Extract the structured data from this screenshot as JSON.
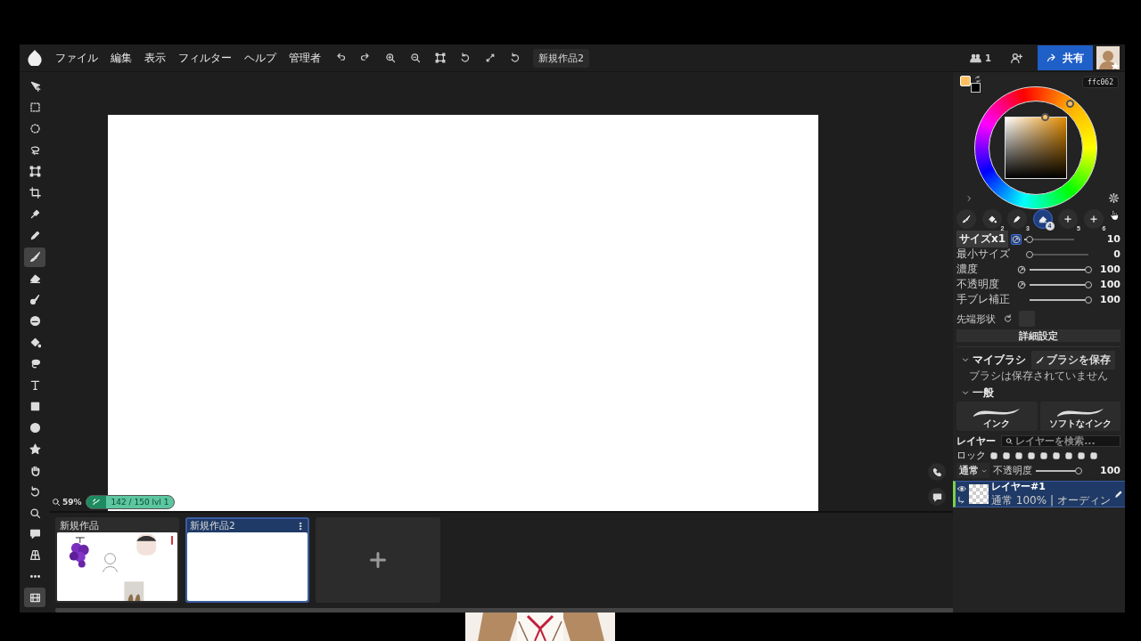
{
  "menubar": {
    "menus": [
      "ファイル",
      "編集",
      "表示",
      "フィルター",
      "ヘルプ",
      "管理者"
    ],
    "document_title": "新規作品2",
    "member_count": "1",
    "share_label": "共有"
  },
  "tools": [
    {
      "kind": "move",
      "selected": false
    },
    {
      "kind": "rect-select",
      "selected": false
    },
    {
      "kind": "ellipse-select",
      "selected": false
    },
    {
      "kind": "lasso",
      "selected": false
    },
    {
      "kind": "transform",
      "selected": false
    },
    {
      "kind": "crop",
      "selected": false
    },
    {
      "kind": "eyedropper",
      "selected": false
    },
    {
      "kind": "pencil",
      "selected": false
    },
    {
      "kind": "brush",
      "selected": true
    },
    {
      "kind": "eraser",
      "selected": false
    },
    {
      "kind": "brush-blur",
      "selected": false
    },
    {
      "kind": "smudge",
      "selected": false
    },
    {
      "kind": "bucket",
      "selected": false
    },
    {
      "kind": "lasso-fill",
      "selected": false
    },
    {
      "kind": "text",
      "selected": false
    },
    {
      "kind": "rectangle",
      "selected": false
    },
    {
      "kind": "ellipse",
      "selected": false
    },
    {
      "kind": "star",
      "selected": false
    },
    {
      "kind": "hand",
      "selected": false
    },
    {
      "kind": "rotate",
      "selected": false
    },
    {
      "kind": "zoom",
      "selected": false
    },
    {
      "kind": "comment",
      "selected": false
    },
    {
      "kind": "perspective",
      "selected": false
    },
    {
      "kind": "more",
      "selected": false
    },
    {
      "kind": "film",
      "selected": true
    }
  ],
  "canvas": {
    "zoom": "59%",
    "progress": "142 / 150  lvl 1"
  },
  "documents": [
    {
      "title": "新規作品",
      "selected": false,
      "kind": "picture"
    },
    {
      "title": "新規作品2",
      "selected": true,
      "kind": "blank"
    }
  ],
  "color": {
    "hex": "ffc062"
  },
  "brush_slots": [
    {
      "kind": "brush",
      "selected": false
    },
    {
      "kind": "bucket",
      "number": "2",
      "selected": false
    },
    {
      "kind": "pen",
      "number": "3",
      "selected": false
    },
    {
      "kind": "eraser",
      "number": "4",
      "selected": true
    },
    {
      "kind": "plus",
      "number": "5",
      "selected": false
    },
    {
      "kind": "plus",
      "number": "6",
      "selected": false
    }
  ],
  "brush_settings": [
    {
      "label": "サイズx1",
      "kind": "button",
      "pressure": true,
      "value": "10",
      "level": 0.1
    },
    {
      "label": "最小サイズ",
      "kind": "text",
      "value": "0",
      "level": 0
    },
    {
      "label": "濃度",
      "kind": "text",
      "pressure": false,
      "value": "100",
      "level": 1
    },
    {
      "label": "不透明度",
      "kind": "text",
      "pressure": false,
      "value": "100",
      "level": 1
    },
    {
      "label": "手ブレ補正",
      "kind": "text",
      "value": "100",
      "level": 1
    }
  ],
  "tip_shape_label": "先端形状",
  "detail_button": "詳細設定",
  "my_brushes": {
    "title": "マイブラシ",
    "expanded": true,
    "save_button": "ブラシを保存",
    "empty_message": "ブラシは保存されていません"
  },
  "general": {
    "title": "一般",
    "expanded": true,
    "brushes": [
      "インク",
      "ソフトなインク"
    ]
  },
  "layers": {
    "title": "レイヤー",
    "search_placeholder": "レイヤーを検索...",
    "lock_label": "ロック",
    "blend_mode": "通常",
    "opacity": {
      "label": "不透明度",
      "value": "100",
      "level": 1
    },
    "items": [
      {
        "name": "レイヤー#1",
        "info": "通常 100% | オーディン",
        "selected": true,
        "visible": true
      }
    ]
  }
}
